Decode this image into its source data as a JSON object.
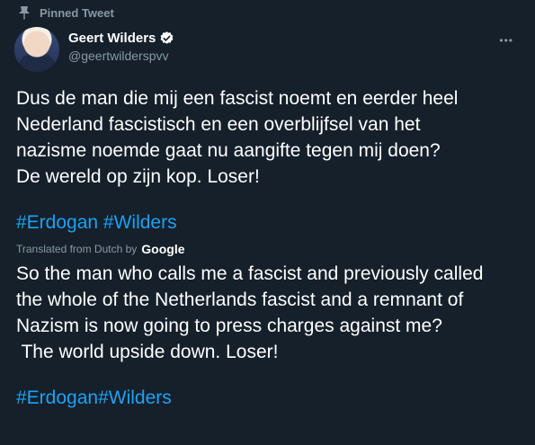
{
  "pinned": {
    "label": "Pinned Tweet",
    "icon": "pin-icon"
  },
  "author": {
    "display_name": "Geert Wilders",
    "handle": "@geertwilderspvv",
    "verified_icon": "verified-badge-icon",
    "verified_color": "#ffffff"
  },
  "more_icon": "more-options-icon",
  "original": {
    "lines": [
      "Dus de man die mij een fascist noemt en eerder heel",
      "Nederland fascistisch en een overblijfsel van het",
      "nazisme noemde gaat nu aangifte tegen mij doen?",
      "De wereld op zijn kop. Loser!"
    ],
    "hashtags": "#Erdogan #Wilders"
  },
  "translation": {
    "label": "Translated from Dutch by",
    "provider": "Google",
    "lines": [
      "So the man who calls me a fascist and previously called",
      "the whole of the Netherlands fascist and a remnant of",
      "Nazism is now going to press charges against me?",
      " The world upside down. Loser!"
    ],
    "hashtags": "#Erdogan#Wilders"
  },
  "colors": {
    "background": "#15202b",
    "secondary_text": "#8899a6",
    "link": "#1da1f2"
  }
}
